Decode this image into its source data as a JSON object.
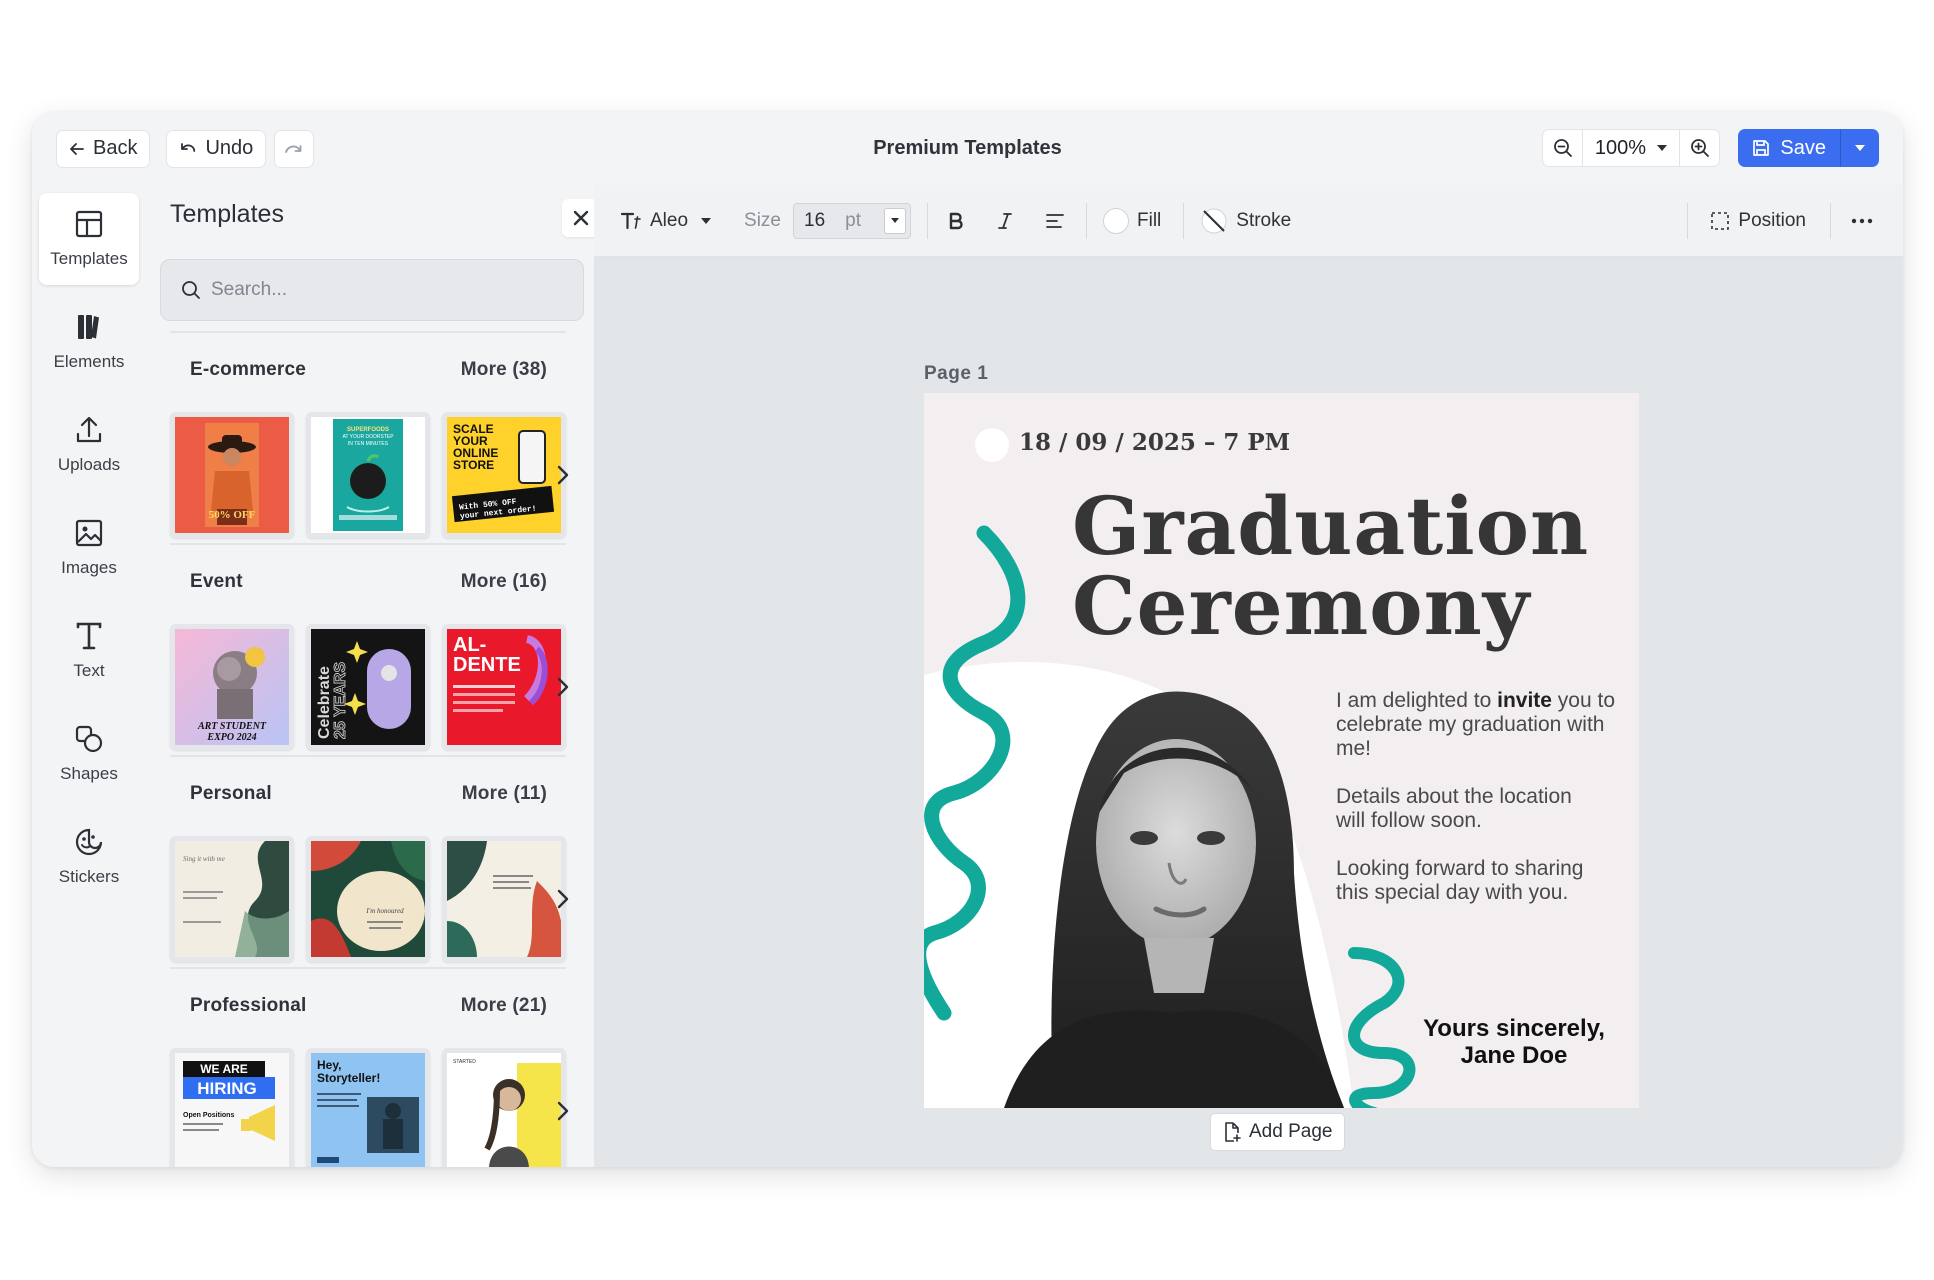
{
  "window": {
    "title": "Premium Templates"
  },
  "topbar": {
    "back_label": "Back",
    "undo_label": "Undo",
    "zoom_value": "100%",
    "save_label": "Save"
  },
  "rail": [
    {
      "label": "Templates",
      "icon": "layout-icon"
    },
    {
      "label": "Elements",
      "icon": "elements-icon"
    },
    {
      "label": "Uploads",
      "icon": "upload-icon"
    },
    {
      "label": "Images",
      "icon": "image-icon"
    },
    {
      "label": "Text",
      "icon": "text-icon"
    },
    {
      "label": "Shapes",
      "icon": "shapes-icon"
    },
    {
      "label": "Stickers",
      "icon": "sticker-icon"
    }
  ],
  "panel": {
    "title": "Templates",
    "search_placeholder": "Search...",
    "sections": [
      {
        "name": "E-commerce",
        "more": "More (38)"
      },
      {
        "name": "Event",
        "more": "More (16)"
      },
      {
        "name": "Personal",
        "more": "More (11)"
      },
      {
        "name": "Professional",
        "more": "More (21)"
      }
    ],
    "thumb_text": {
      "ecom_1": "50% OFF",
      "ecom_2": "SUPERFOODS AT YOUR DOORSTEP IN TEN MINUTES",
      "ecom_3": "SCALE YOUR ONLINE STORE",
      "ecom_3b": "With 50% OFF your next order!",
      "event_1": "ART STUDENT EXPO 2024",
      "event_2": "Celebrate 25 YEARS",
      "event_3": "AL- DENTE",
      "prof_1a": "WE ARE",
      "prof_1b": "HIRING",
      "prof_1c": "Open Positions",
      "prof_2": "Hey, Storyteller!"
    }
  },
  "toolbar": {
    "font": "Aleo",
    "size_label": "Size",
    "size_value": "16",
    "size_unit": "pt",
    "fill_label": "Fill",
    "stroke_label": "Stroke",
    "position_label": "Position"
  },
  "canvas": {
    "page_label": "Page  1",
    "date": "18 / 09 / 2025 – 7 PM",
    "title_line1": "Graduation",
    "title_line2": "Ceremony",
    "p1_a": "I am delighted to ",
    "p1_bold": "invite",
    "p1_b": " you to celebrate my graduation with me!",
    "p2": "Details about the location will follow soon.",
    "p3": "Looking forward to sharing this special day with you.",
    "sign_1": "Yours sincerely,",
    "sign_2": "Jane Doe",
    "add_page_label": "Add Page"
  },
  "colors": {
    "accent": "#3b6df0",
    "teal": "#12a99b",
    "page_bg": "#f3eef0"
  }
}
